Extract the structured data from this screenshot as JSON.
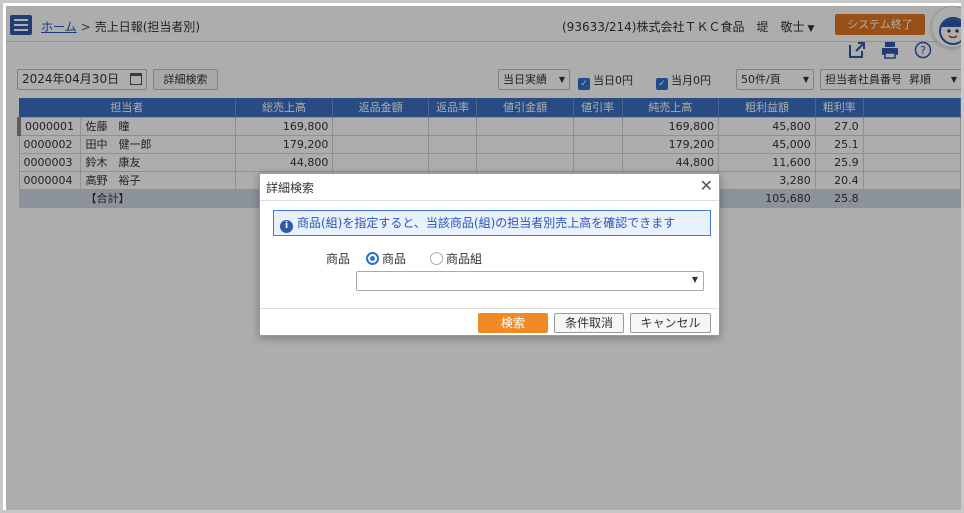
{
  "header": {
    "breadcrumb_home": "ホーム",
    "breadcrumb_sep": ">",
    "breadcrumb_current": "売上日報(担当者別)",
    "company": "(93633/214)株式会社ＴＫＣ食品　堤　敬士",
    "exit_label": "システム終了"
  },
  "filters": {
    "date": "2024年04月30日",
    "advanced_label": "詳細検索",
    "mode": "当日実績",
    "today_zero": "当日0円",
    "month_zero": "当月0円",
    "per_page": "50件/頁",
    "sort_field": "担当者社員番号",
    "sort_order": "昇順"
  },
  "table": {
    "headers": [
      "担当者",
      "総売上高",
      "返品金額",
      "返品率",
      "値引金額",
      "値引率",
      "純売上高",
      "粗利益額",
      "粗利率"
    ],
    "rows": [
      {
        "code": "0000001",
        "name": "佐藤　瞳",
        "total": "169,800",
        "ret": "",
        "ret_rate": "",
        "disc": "",
        "disc_rate": "",
        "net": "169,800",
        "profit": "45,800",
        "rate": "27.0"
      },
      {
        "code": "0000002",
        "name": "田中　健一郎",
        "total": "179,200",
        "ret": "",
        "ret_rate": "",
        "disc": "",
        "disc_rate": "",
        "net": "179,200",
        "profit": "45,000",
        "rate": "25.1"
      },
      {
        "code": "0000003",
        "name": "鈴木　康友",
        "total": "44,800",
        "ret": "",
        "ret_rate": "",
        "disc": "",
        "disc_rate": "",
        "net": "44,800",
        "profit": "11,600",
        "rate": "25.9"
      },
      {
        "code": "0000004",
        "name": "高野　裕子",
        "total": "",
        "ret": "",
        "ret_rate": "",
        "disc": "",
        "disc_rate": "",
        "net": "",
        "profit": "3,280",
        "rate": "20.4"
      }
    ],
    "total_label": "【合計】",
    "total_profit": "105,680",
    "total_rate": "25.8"
  },
  "dialog": {
    "title": "詳細検索",
    "info": "商品(組)を指定すると、当該商品(組)の担当者別売上高を確認できます",
    "product_label": "商品",
    "radio_product": "商品",
    "radio_group": "商品組",
    "search_label": "検索",
    "clear_label": "条件取消",
    "cancel_label": "キャンセル"
  },
  "colors": {
    "accent": "#e27622",
    "primary_blue": "#3a6fc0"
  }
}
